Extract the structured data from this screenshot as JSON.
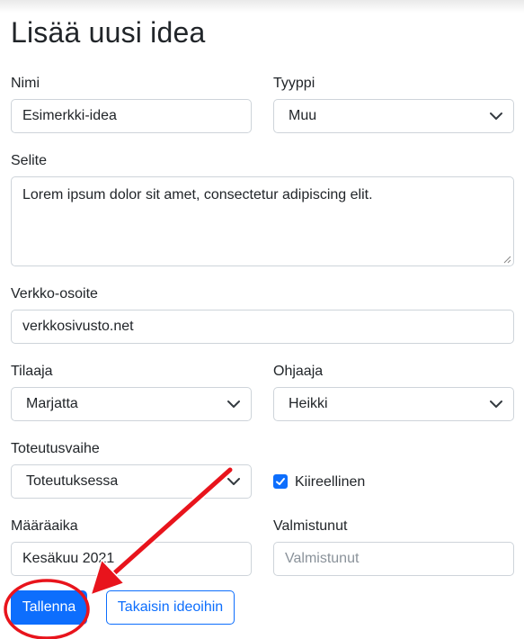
{
  "page": {
    "title": "Lisää uusi idea"
  },
  "form": {
    "name": {
      "label": "Nimi",
      "value": "Esimerkki-idea"
    },
    "type": {
      "label": "Tyyppi",
      "value": "Muu"
    },
    "description": {
      "label": "Selite",
      "value": "Lorem ipsum dolor sit amet, consectetur adipiscing elit."
    },
    "url": {
      "label": "Verkko-osoite",
      "value": "verkkosivusto.net"
    },
    "orderer": {
      "label": "Tilaaja",
      "value": "Marjatta"
    },
    "supervisor": {
      "label": "Ohjaaja",
      "value": "Heikki"
    },
    "stage": {
      "label": "Toteutusvaihe",
      "value": "Toteutuksessa"
    },
    "urgent": {
      "label": "Kiireellinen",
      "checked": true
    },
    "deadline": {
      "label": "Määräaika",
      "value": "Kesäkuu 2021"
    },
    "completed": {
      "label": "Valmistunut",
      "value": "",
      "placeholder": "Valmistunut"
    }
  },
  "buttons": {
    "save": "Tallenna",
    "back": "Takaisin ideoihin"
  },
  "colors": {
    "primary": "#0d6efd",
    "annotation": "#e8141c",
    "border": "#ced4da"
  },
  "icons": [
    "chevron-down-icon",
    "check-icon",
    "resize-grip-icon",
    "annotation-arrow",
    "annotation-circle"
  ]
}
